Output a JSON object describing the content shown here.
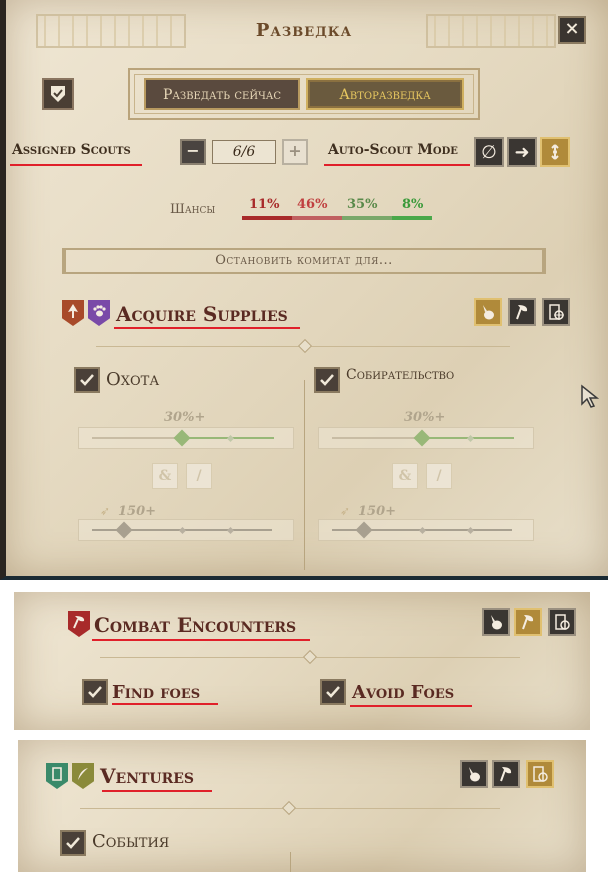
{
  "header": {
    "title": "Разведка",
    "close_label": "×"
  },
  "actions": {
    "scout_now": "Разведать сейчас",
    "auto_scout": "Авторазведка"
  },
  "scouts": {
    "label": "Assigned Scouts",
    "count": "6/6",
    "minus": "−",
    "plus": "+"
  },
  "auto_scout_mode": {
    "label": "Auto-Scout Mode",
    "icons": [
      "none-icon",
      "arrow-right-icon",
      "scatter-icon"
    ],
    "active_index": 2,
    "none_glyph": "∅",
    "arrow_glyph": "➜"
  },
  "chances": {
    "label": "Шансы",
    "values": [
      {
        "text": "11%",
        "color": "#a82a2a"
      },
      {
        "text": "46%",
        "color": "#c04040"
      },
      {
        "text": "35%",
        "color": "#5a8a4a"
      },
      {
        "text": "8%",
        "color": "#3a9a3a"
      }
    ]
  },
  "stop_button": "Остановить комитат для...",
  "sections": {
    "supplies": {
      "title": "Acquire Supplies",
      "badges": [
        {
          "icon": "arrowhead-icon",
          "color": "#a84a2a"
        },
        {
          "icon": "paw-icon",
          "color": "#7a4aa8"
        }
      ],
      "active_category": 0,
      "hunting": {
        "label": "Охота",
        "chance": "30%+",
        "amount": "150+"
      },
      "gathering": {
        "label": "Собирательство",
        "chance": "30%+",
        "amount": "150+"
      },
      "and_label": "&",
      "or_label": "/"
    },
    "combat": {
      "title": "Combat Encounters",
      "badges": [
        {
          "icon": "axe-icon",
          "color": "#a82a2a"
        }
      ],
      "active_category": 1,
      "find": "Find foes",
      "avoid": "Avoid Foes"
    },
    "ventures": {
      "title": "Ventures",
      "badges": [
        {
          "icon": "scroll-icon",
          "color": "#3a8a6a"
        },
        {
          "icon": "feather-icon",
          "color": "#8a8a3a"
        }
      ],
      "active_category": 2,
      "events": "События"
    }
  },
  "colors": {
    "accent": "#e0202a",
    "gold": "#b08a3a",
    "slider_green": "#98b878",
    "slider_gray": "#a8a090"
  }
}
